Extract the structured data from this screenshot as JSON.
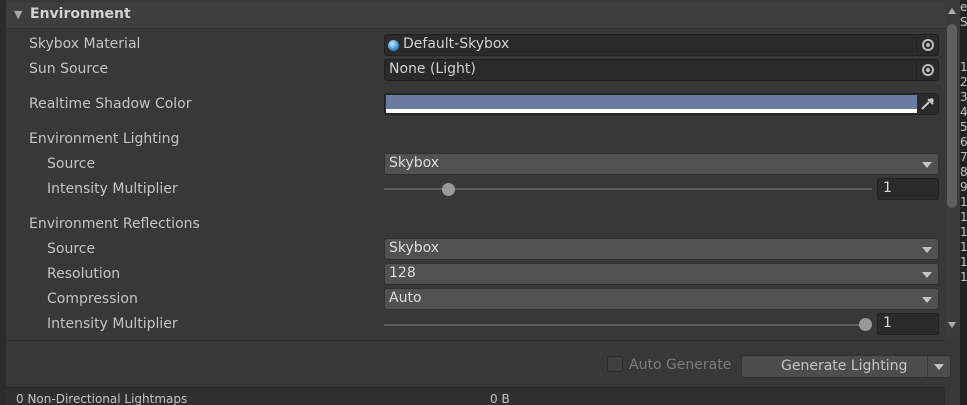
{
  "section": {
    "title": "Environment"
  },
  "skybox_material": {
    "label": "Skybox Material",
    "value": "Default-Skybox"
  },
  "sun_source": {
    "label": "Sun Source",
    "value": "None (Light)"
  },
  "shadow_color": {
    "label": "Realtime Shadow Color",
    "color": "#6a7ba1"
  },
  "env_lighting": {
    "label": "Environment Lighting",
    "source_label": "Source",
    "source_value": "Skybox",
    "intensity_label": "Intensity Multiplier",
    "intensity_value": "1"
  },
  "env_reflections": {
    "label": "Environment Reflections",
    "source_label": "Source",
    "source_value": "Skybox",
    "resolution_label": "Resolution",
    "resolution_value": "128",
    "compression_label": "Compression",
    "compression_value": "Auto",
    "intensity_label": "Intensity Multiplier",
    "intensity_value": "1"
  },
  "footer": {
    "auto_generate_label": "Auto Generate",
    "generate_button_label": "Generate Lighting",
    "lightmaps_text": "0 Non-Directional Lightmaps",
    "size_text": "0 B"
  },
  "right_strip": {
    "lines": [
      "e",
      "S",
      "",
      "",
      "1",
      "2",
      "3",
      "4",
      "5",
      "6",
      "7",
      "8",
      "9",
      "1",
      "1",
      "1",
      "1",
      "1",
      "1"
    ]
  }
}
